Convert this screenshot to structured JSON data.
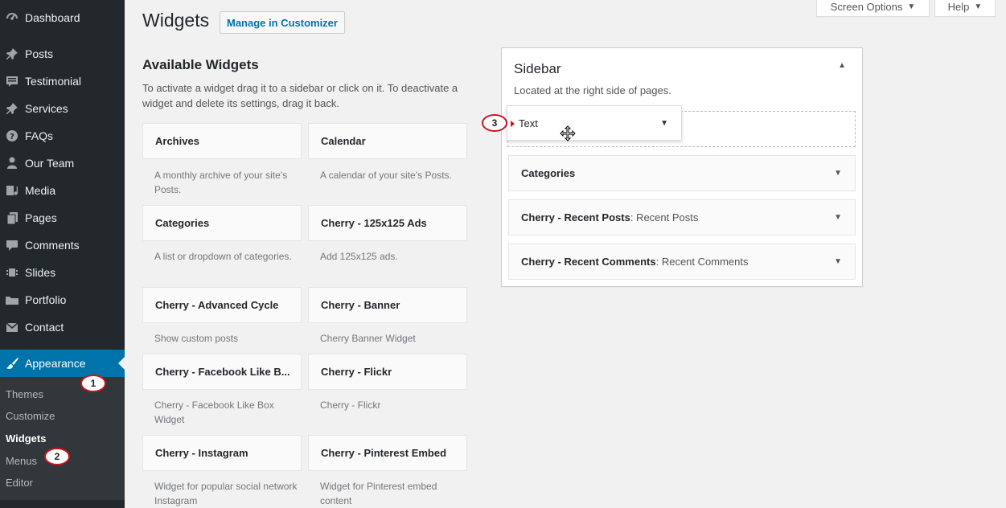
{
  "menu": [
    {
      "label": "Dashboard",
      "icon": "dashboard-icon"
    },
    {
      "label": "Posts",
      "icon": "pin-icon"
    },
    {
      "label": "Testimonial",
      "icon": "testimonial-icon"
    },
    {
      "label": "Services",
      "icon": "pin-icon"
    },
    {
      "label": "FAQs",
      "icon": "question-icon"
    },
    {
      "label": "Our Team",
      "icon": "user-icon"
    },
    {
      "label": "Media",
      "icon": "media-icon"
    },
    {
      "label": "Pages",
      "icon": "pages-icon"
    },
    {
      "label": "Comments",
      "icon": "comment-icon"
    },
    {
      "label": "Slides",
      "icon": "slides-icon"
    },
    {
      "label": "Portfolio",
      "icon": "folder-icon"
    },
    {
      "label": "Contact",
      "icon": "mail-icon"
    },
    {
      "label": "Appearance",
      "icon": "brush-icon"
    }
  ],
  "submenu": [
    {
      "label": "Themes"
    },
    {
      "label": "Customize"
    },
    {
      "label": "Widgets"
    },
    {
      "label": "Menus"
    },
    {
      "label": "Editor"
    }
  ],
  "callouts": [
    "1",
    "2",
    "3"
  ],
  "header": {
    "title": "Widgets",
    "action": "Manage in Customizer",
    "screen_options": "Screen Options",
    "help": "Help"
  },
  "available": {
    "title": "Available Widgets",
    "description": "To activate a widget drag it to a sidebar or click on it. To deactivate a widget and delete its settings, drag it back.",
    "widgets": [
      {
        "title": "Archives",
        "desc": "A monthly archive of your site’s Posts."
      },
      {
        "title": "Calendar",
        "desc": "A calendar of your site’s Posts."
      },
      {
        "title": "Categories",
        "desc": "A list or dropdown of categories."
      },
      {
        "title": "Cherry - 125x125 Ads",
        "desc": "Add 125x125 ads."
      },
      {
        "title": "Cherry - Advanced Cycle",
        "desc": "Show custom posts"
      },
      {
        "title": "Cherry - Banner",
        "desc": "Cherry Banner Widget"
      },
      {
        "title": "Cherry - Facebook Like B...",
        "desc": "Cherry - Facebook Like Box Widget"
      },
      {
        "title": "Cherry - Flickr",
        "desc": "Cherry - Flickr"
      },
      {
        "title": "Cherry - Instagram",
        "desc": "Widget for popular social network Instagram"
      },
      {
        "title": "Cherry - Pinterest Embed",
        "desc": "Widget for Pinterest embed content"
      }
    ]
  },
  "sidebar_area": {
    "title": "Sidebar",
    "description": "Located at the right side of pages.",
    "dragging_widget": "Text",
    "widgets": [
      {
        "title": "Categories",
        "subtitle": ""
      },
      {
        "title": "Cherry - Recent Posts",
        "subtitle": ": Recent Posts"
      },
      {
        "title": "Cherry - Recent Comments",
        "subtitle": ": Recent Comments"
      }
    ]
  },
  "colors": {
    "accent": "#0073aa",
    "menu_bg": "#23282d",
    "submenu_bg": "#32373c",
    "callout": "#d0101a"
  }
}
